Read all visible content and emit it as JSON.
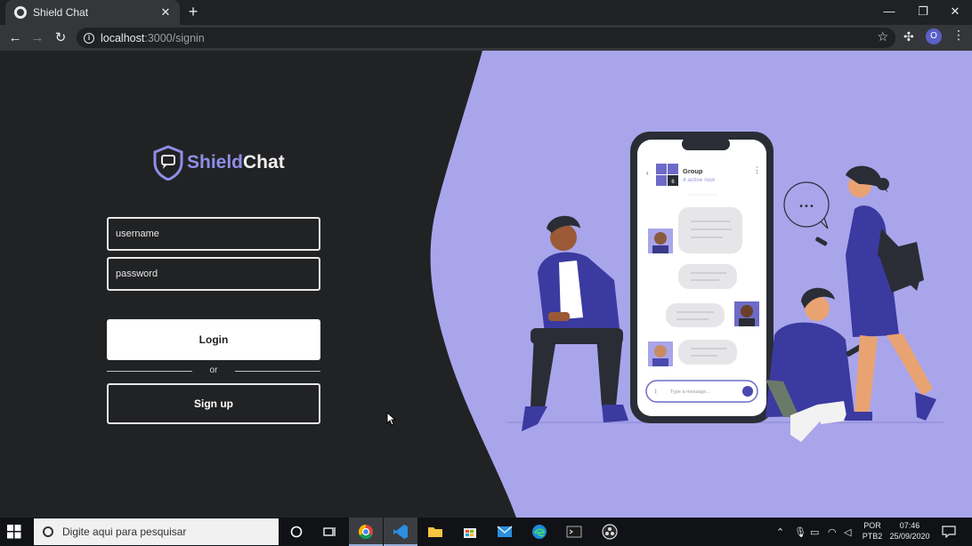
{
  "browser": {
    "tab_title": "Shield Chat",
    "tab_close": "✕",
    "new_tab": "+",
    "url_host": "localhost",
    "url_path": ":3000/signin",
    "profile_initial": "O"
  },
  "window_controls": {
    "minimize": "—",
    "restore": "❐",
    "close": "✕"
  },
  "logo": {
    "part1": "Shield",
    "part2": "Chat"
  },
  "form": {
    "username_placeholder": "username",
    "password_placeholder": "password",
    "login_label": "Login",
    "or_label": "or",
    "signup_label": "Sign up"
  },
  "illustration": {
    "group_name": "Group",
    "group_status": "4 active now",
    "group_badge": "6",
    "message_placeholder": "Type a message...",
    "bubble_dots": "•••"
  },
  "taskbar": {
    "search_placeholder": "Digite aqui para pesquisar",
    "lang_top": "POR",
    "lang_bottom": "PTB2",
    "time": "07:46",
    "date": "25/09/2020"
  },
  "colors": {
    "page_dark": "#212224",
    "accent_purple": "#a9a5eb",
    "logo_purple": "#8f8ee8"
  }
}
